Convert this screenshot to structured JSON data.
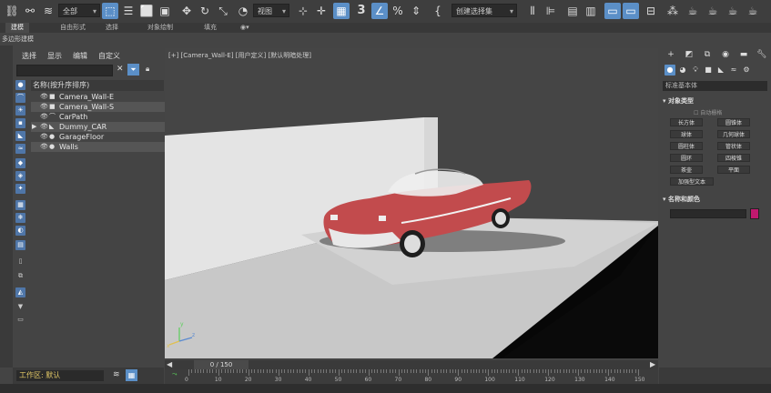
{
  "toolbar": {
    "selection_filter": "全部",
    "coordinate_system": "视图",
    "snap_angle": "3",
    "named_selection": "创建选择集"
  },
  "ribbon": {
    "tabs": [
      "建模",
      "自由形式",
      "选择",
      "对象绘制",
      "填充"
    ],
    "sub_label": "多边形建模"
  },
  "explorer": {
    "menus": [
      "选择",
      "显示",
      "编辑",
      "自定义"
    ],
    "column_header": "名称(按升序排序)",
    "items": [
      {
        "name": "Camera_Wall-E",
        "type": "camera"
      },
      {
        "name": "Camera_Wall-S",
        "type": "camera"
      },
      {
        "name": "CarPath",
        "type": "shape"
      },
      {
        "name": "Dummy_CAR",
        "type": "helper"
      },
      {
        "name": "GarageFloor",
        "type": "geometry"
      },
      {
        "name": "Walls",
        "type": "geometry"
      }
    ],
    "workspace": "工作区: 默认"
  },
  "viewport": {
    "label": "[+] [Camera_Wall-E] [用户定义] [默认明暗处理]",
    "axis_x": "x",
    "axis_y": "y",
    "axis_z": "z"
  },
  "timeline": {
    "slider": "0 / 150",
    "ticks": [
      "0",
      "10",
      "20",
      "30",
      "40",
      "50",
      "60",
      "70",
      "80",
      "90",
      "100",
      "110",
      "120",
      "130",
      "140",
      "150"
    ]
  },
  "command_panel": {
    "category": "标准基本体",
    "section_object_type": "对象类型",
    "autogrid": "自动栅格",
    "buttons": [
      "长方体",
      "圆锥体",
      "球体",
      "几何球体",
      "圆柱体",
      "管状体",
      "圆环",
      "四棱锥",
      "茶壶",
      "平面",
      "加强型文本"
    ],
    "section_name_color": "名称和颜色",
    "object_color": "#c0196f"
  }
}
